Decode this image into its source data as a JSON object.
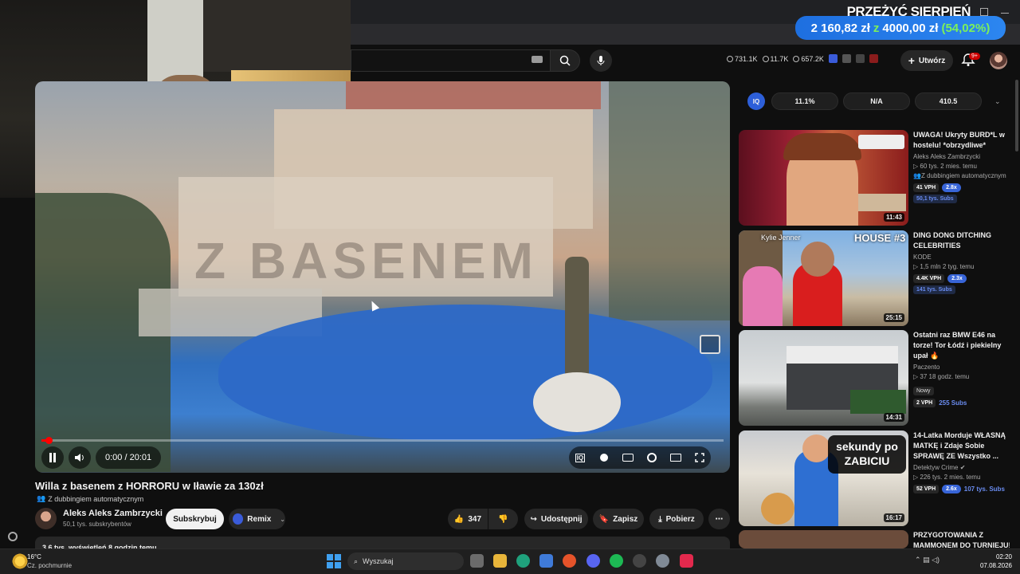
{
  "promo": {
    "title": "PRZEŻYĆ SIERPIEŃ",
    "current": "2 160,82 zł",
    "joiner": "z",
    "goal": "4000,00 zł",
    "percent": "(54,02%)",
    "brand_color": "#2c86f0"
  },
  "header_stats": {
    "views": "731.1K",
    "likes": "11.7K",
    "other": "657.2K"
  },
  "header": {
    "create_label": "Utwórz",
    "notif_badge": "9+"
  },
  "video": {
    "title": "Willa z basenem z HORRORU w Iławie za 130zł",
    "dubbing": "Z dubbingiem automatycznym",
    "watermark": "Z BASENEM",
    "time": "0:00 / 20:01",
    "progress": 0.01
  },
  "channel": {
    "name": "Aleks Aleks Zambrzycki",
    "subs": "50,1 tys. subskrybentów",
    "subscribe": "Subskrybuj",
    "remix": "Remix"
  },
  "actions": {
    "likes": "347",
    "share": "Udostępnij",
    "save": "Zapisz",
    "download": "Pobierz"
  },
  "description": {
    "line": "3,6 tys. wyświetleń  8 godzin temu"
  },
  "ext": {
    "v1": "11.1%",
    "v2": "N/A",
    "v3": "410.5",
    "logo": "IQ"
  },
  "recs": [
    {
      "title": "UWAGA! Ukryty BURD*L w hostelu! *obrzydliwe*",
      "channel": "Aleks Aleks Zambrzycki",
      "meta": "60 tys.  2 mies. temu",
      "dub": "Z dubbingiem automatycznym",
      "vph": "41 VPH",
      "mult": "2.8x",
      "subs": "50,1 tys. Subs",
      "duration": "11:43"
    },
    {
      "title": "DING DONG DITCHING CELEBRITIES",
      "channel": "KODE",
      "meta": "1,5 mln  2 tyg. temu",
      "vph": "4.4K VPH",
      "mult": "2.3x",
      "subs": "141 tys. Subs",
      "duration": "25:15",
      "thumb_text": "HOUSE #3",
      "thumb_label": "Kylie Jenner"
    },
    {
      "title": "Ostatni raz BMW E46 na torze! Tor Łódź i piekielny upał 🔥",
      "channel": "Paczento",
      "meta": "37  18 godz. temu",
      "badge": "Nowy",
      "vph": "2 VPH",
      "subs": "255 Subs",
      "duration": "14:31"
    },
    {
      "title": "14-Latka Morduje WŁASNĄ MATKĘ i Zdaje Sobie SPRAWĘ ZE Wszystko ...",
      "channel": "Detektyw Crime",
      "meta": "226 tys.  2 mies. temu",
      "vph": "52 VPH",
      "mult": "2.6x",
      "subs": "107 tys. Subs",
      "duration": "16:17",
      "thumb_text": "sekundy po ZABICIU"
    },
    {
      "title": "PRZYGOTOWANIA Z MAMMONEM DO TURNIEJU!"
    }
  ],
  "taskbar": {
    "temp": "16°C",
    "weather": "Cz. pochmurnie",
    "search": "Wyszukaj",
    "time": "02:20",
    "date": "07.08.2026"
  }
}
